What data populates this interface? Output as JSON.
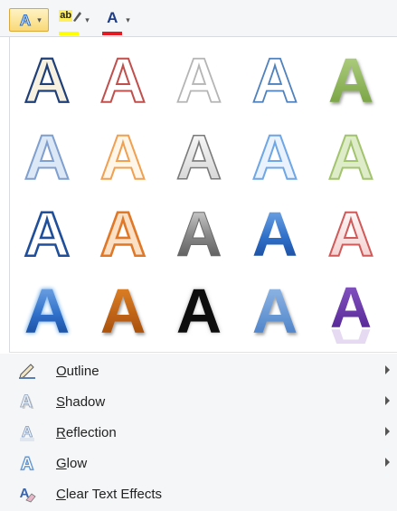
{
  "toolbar": {
    "text_effects_glyph": "A",
    "highlight_glyph": "ab",
    "font_color_glyph": "A",
    "highlight_color": "#ffff00",
    "font_color": "#e51b24"
  },
  "gallery": {
    "glyph": "A",
    "rows": 4,
    "columns": 5,
    "styles": [
      "outline-navy-cream",
      "outline-red-light",
      "outline-gray-light",
      "outline-blue-light",
      "fill-green-shadow",
      "soft-blue-outline",
      "soft-orange-outline",
      "gradient-gray-outline",
      "soft-light-blue",
      "soft-light-green",
      "outline-navy-strong",
      "fill-orange-outline",
      "gradient-silver",
      "fill-blue-gradient",
      "outline-red-soft",
      "fill-blue-glow",
      "fill-orange-dark",
      "fill-black-glow",
      "fill-blue-soft",
      "fill-purple-reflection"
    ]
  },
  "menu": {
    "items": [
      {
        "pre": "",
        "ul": "O",
        "post": "utline",
        "has_submenu": true,
        "icon": "outline-pen-icon"
      },
      {
        "pre": "",
        "ul": "S",
        "post": "hadow",
        "has_submenu": true,
        "icon": "shadow-icon"
      },
      {
        "pre": "",
        "ul": "R",
        "post": "eflection",
        "has_submenu": true,
        "icon": "reflection-icon"
      },
      {
        "pre": "",
        "ul": "G",
        "post": "low",
        "has_submenu": true,
        "icon": "glow-icon"
      },
      {
        "pre": "",
        "ul": "C",
        "post": "lear Text Effects",
        "has_submenu": false,
        "icon": "eraser-icon"
      }
    ]
  }
}
